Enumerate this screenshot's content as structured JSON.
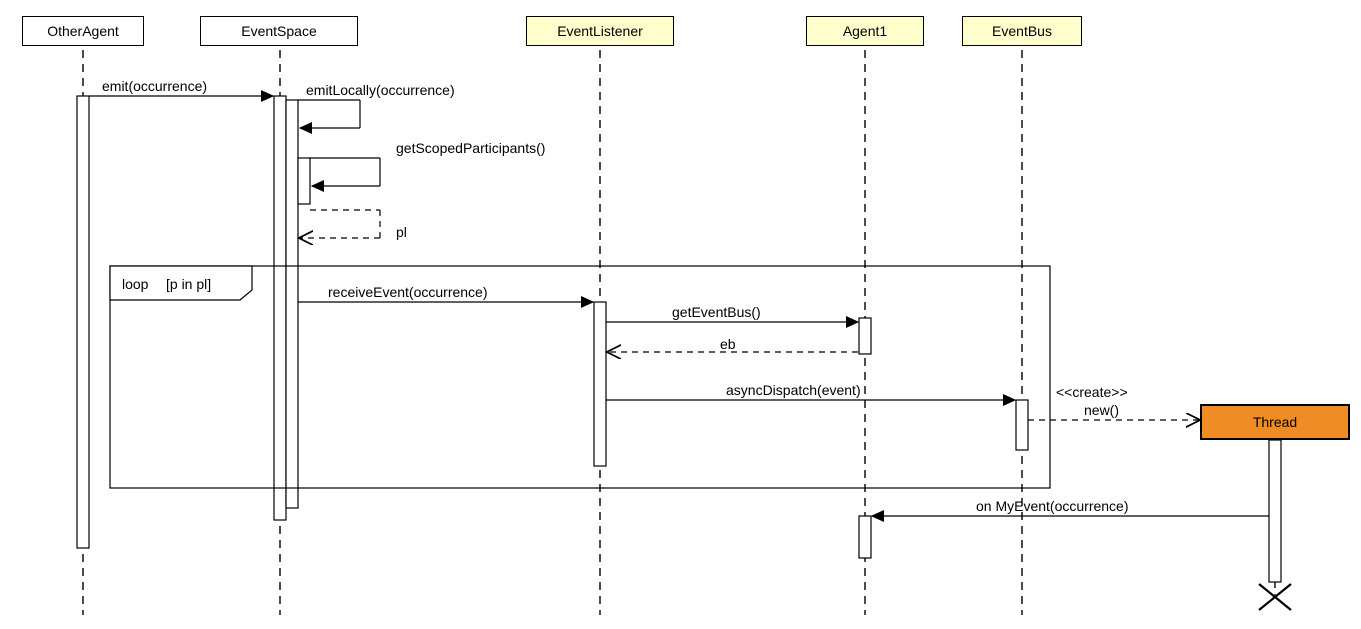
{
  "participants": {
    "otherAgent": "OtherAgent",
    "eventSpace": "EventSpace",
    "eventListener": "EventListener",
    "agent1": "Agent1",
    "eventBus": "EventBus",
    "thread": "Thread"
  },
  "messages": {
    "emit": "emit(occurrence)",
    "emitLocally": "emitLocally(occurrence)",
    "getScopedParticipants": "getScopedParticipants()",
    "plReturn": "pl",
    "receiveEvent": "receiveEvent(occurrence)",
    "getEventBus": "getEventBus()",
    "ebReturn": "eb",
    "asyncDispatch": "asyncDispatch(event)",
    "createStereo": "<<create>>",
    "newCall": "new()",
    "onMyEvent": "on MyEvent(occurrence)"
  },
  "fragment": {
    "operator": "loop",
    "guard": "[p in pl]"
  }
}
